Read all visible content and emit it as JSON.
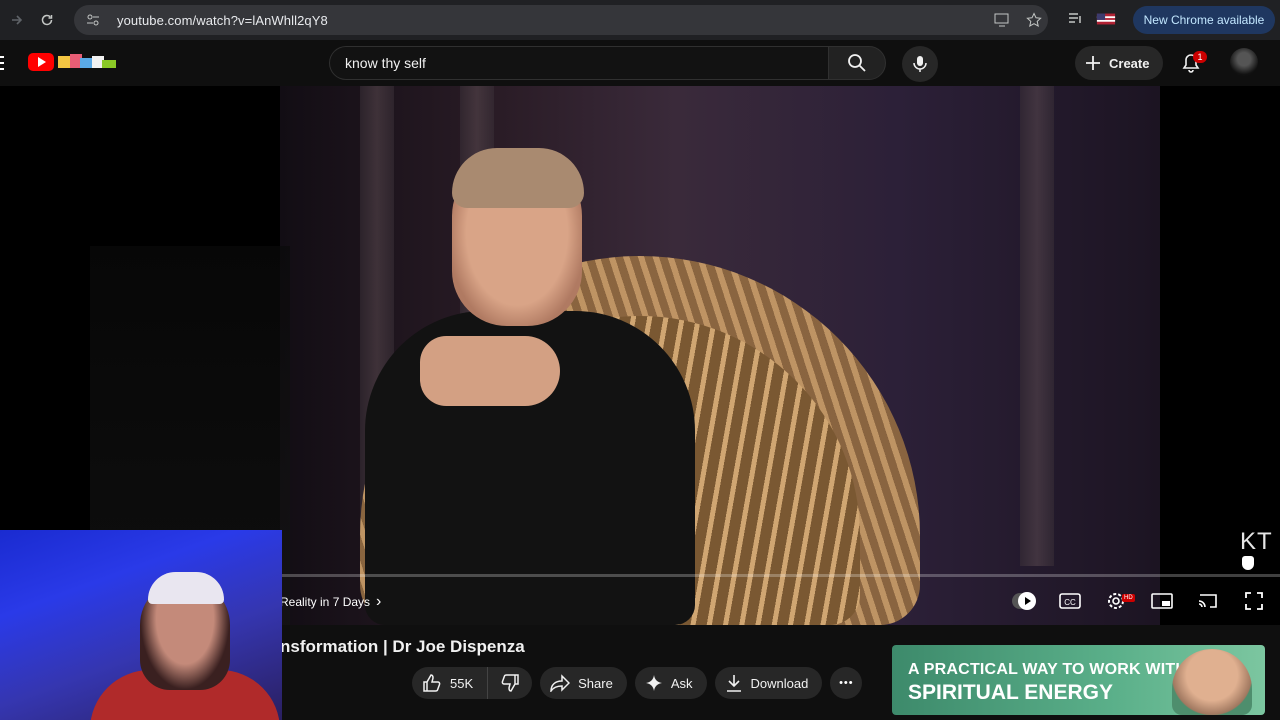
{
  "browser": {
    "url": "youtube.com/watch?v=lAnWhll2qY8",
    "update_label": "New Chrome available"
  },
  "youtube": {
    "search_value": "know thy self",
    "create_label": "Create",
    "notification_count": "1"
  },
  "player": {
    "watermark": "KT",
    "chapter_label": "Reality in 7 Days",
    "chapter_chevron": "›"
  },
  "video": {
    "title_visible": "nsformation | Dr Joe Dispenza",
    "like_count": "55K",
    "share_label": "Share",
    "ask_label": "Ask",
    "download_label": "Download",
    "more_label": "•••"
  },
  "ad": {
    "line1": "A PRACTICAL WAY TO WORK WITH",
    "line2": "SPIRITUAL ENERGY"
  },
  "colors": {
    "youtube_red": "#ff0000",
    "chrome_update_bg": "#1f3760",
    "ad_green": "#4e8e6d"
  }
}
